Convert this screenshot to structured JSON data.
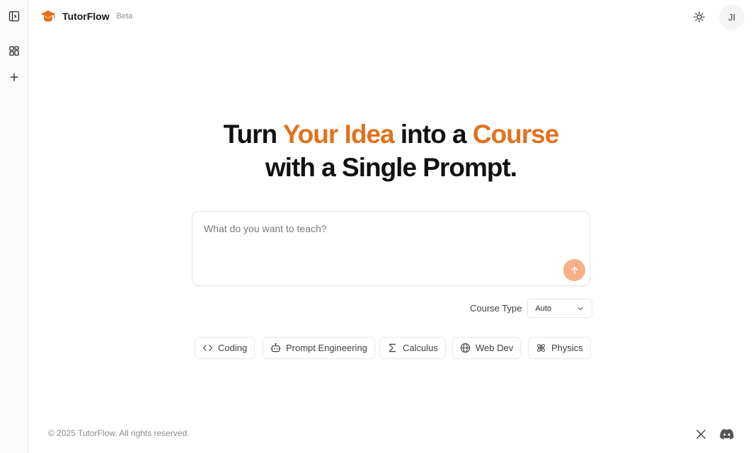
{
  "app": {
    "name": "TutorFlow",
    "badge": "Beta"
  },
  "header": {
    "avatar_initials": "JI"
  },
  "hero": {
    "line1_part1": "Turn ",
    "line1_accent1": "Your Idea",
    "line1_part2": " into a ",
    "line1_accent2": "Course",
    "line2": "with a Single Prompt."
  },
  "prompt": {
    "placeholder": "What do you want to teach?",
    "value": ""
  },
  "course_type": {
    "label": "Course Type",
    "selected": "Auto"
  },
  "suggestions": [
    {
      "label": "Coding",
      "icon": "code-icon"
    },
    {
      "label": "Prompt Engineering",
      "icon": "robot-icon"
    },
    {
      "label": "Calculus",
      "icon": "sigma-icon"
    },
    {
      "label": "Web Dev",
      "icon": "globe-icon"
    },
    {
      "label": "Physics",
      "icon": "atom-icon"
    }
  ],
  "footer": {
    "copyright": "© 2025 TutorFlow. All rights reserved."
  },
  "colors": {
    "accent": "#e2711d",
    "send_button": "#f7b088"
  }
}
